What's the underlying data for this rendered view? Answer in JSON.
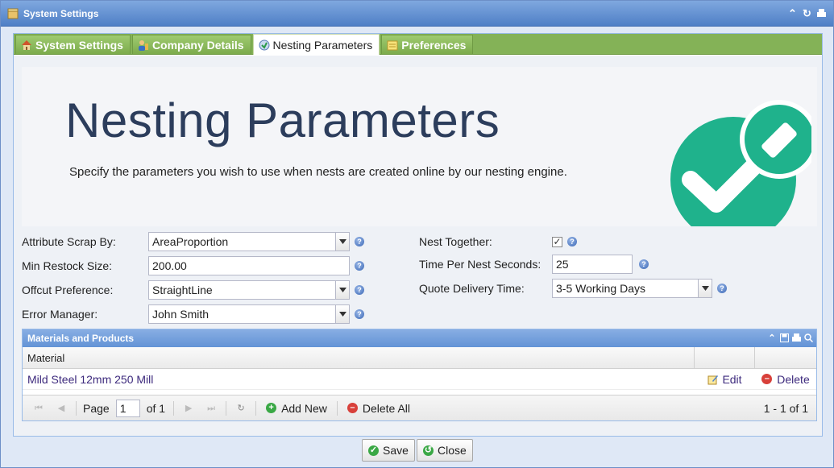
{
  "window": {
    "title": "System Settings"
  },
  "tabs": [
    {
      "label": "System Settings",
      "active": false
    },
    {
      "label": "Company Details",
      "active": false
    },
    {
      "label": "Nesting Parameters",
      "active": true
    },
    {
      "label": "Preferences",
      "active": false
    }
  ],
  "banner": {
    "title": "Nesting Parameters",
    "subtitle": "Specify the parameters you wish to use when nests are created online by our nesting engine."
  },
  "form": {
    "attribute_scrap_by": {
      "label": "Attribute Scrap By:",
      "value": "AreaProportion"
    },
    "min_restock_size": {
      "label": "Min Restock Size:",
      "value": "200.00"
    },
    "offcut_preference": {
      "label": "Offcut Preference:",
      "value": "StraightLine"
    },
    "error_manager": {
      "label": "Error Manager:",
      "value": "John Smith"
    },
    "nest_together": {
      "label": "Nest Together:",
      "checked": true,
      "mark": "✓"
    },
    "time_per_nest": {
      "label": "Time Per Nest Seconds:",
      "value": "25"
    },
    "quote_delivery_time": {
      "label": "Quote Delivery Time:",
      "value": "3-5 Working Days"
    }
  },
  "grid": {
    "title": "Materials and Products",
    "column_material": "Material",
    "rows": [
      {
        "material": "Mild Steel 12mm 250 Mill",
        "edit_label": "Edit",
        "delete_label": "Delete"
      }
    ],
    "pager": {
      "page_label": "Page",
      "page_value": "1",
      "of_label": "of 1",
      "add_new_label": "Add New",
      "delete_all_label": "Delete All",
      "range_text": "1 - 1 of 1"
    }
  },
  "footer": {
    "save_label": "Save",
    "close_label": "Close"
  },
  "colors": {
    "titlebar": "#4f7fc6",
    "tabstrip": "#84b257",
    "banner_title": "#2c3d5c",
    "check_circle": "#1fb28c",
    "link": "#3d2a7d"
  },
  "icons": {
    "help": "?",
    "dropdown": "▼",
    "checkmark": "✓"
  }
}
